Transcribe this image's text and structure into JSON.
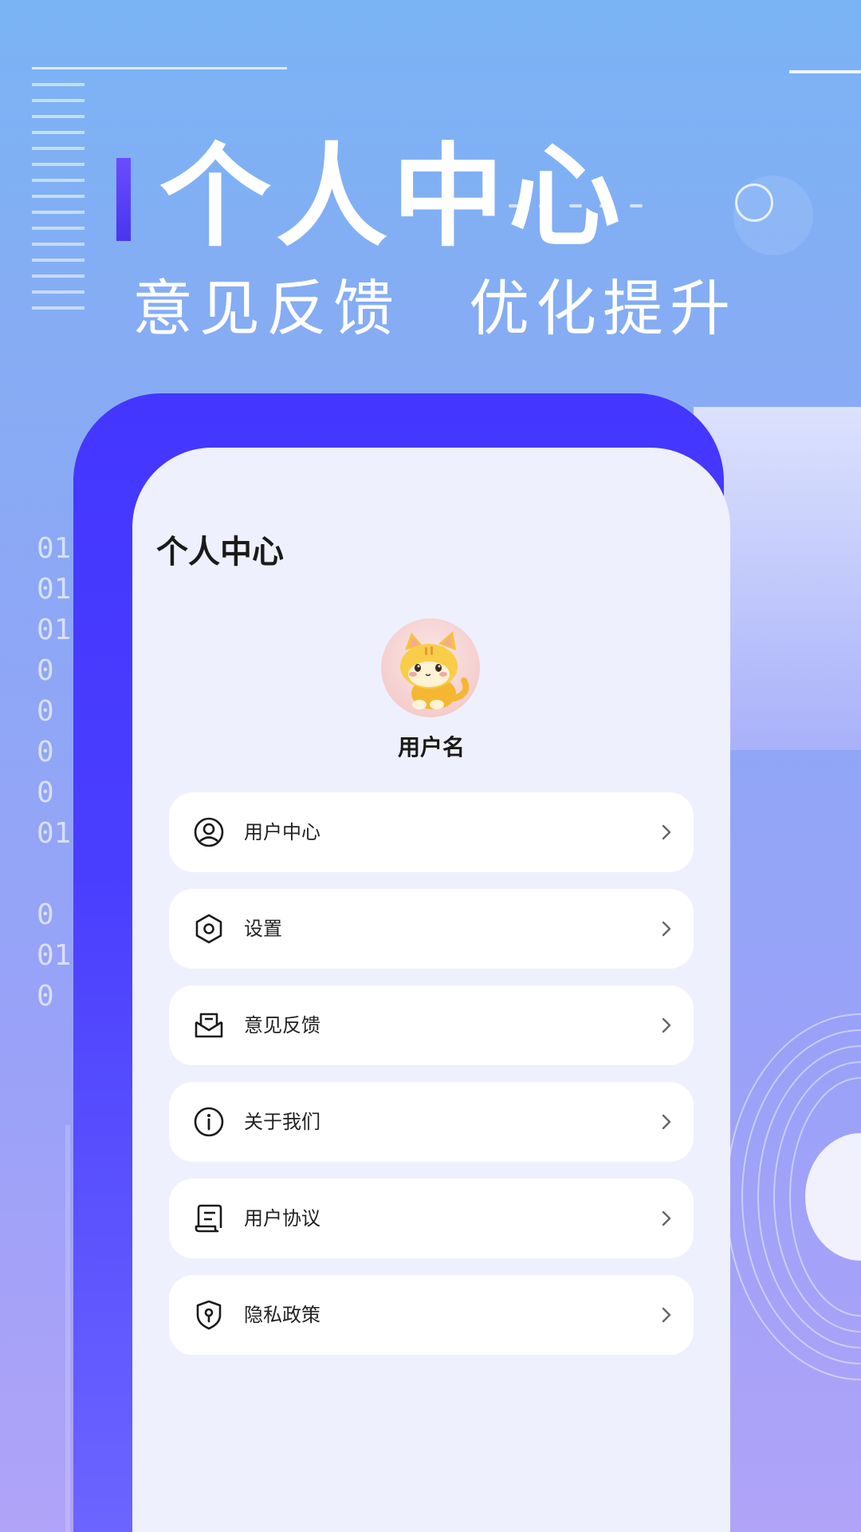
{
  "hero": {
    "title": "个人中心",
    "subtitle_left": "意见反馈",
    "subtitle_right": "优化提升"
  },
  "background": {
    "binary_rows": [
      "01",
      "01",
      "01",
      "0",
      "0",
      "0",
      "0",
      "01",
      "",
      "0",
      "01",
      "0"
    ]
  },
  "colors": {
    "accent": "#4436ff",
    "screen_bg": "#eef0fd",
    "card_bg": "#ffffff",
    "text_primary": "#1a1a1a"
  },
  "screen": {
    "page_title": "个人中心",
    "username": "用户名",
    "avatar_icon": "cat-avatar"
  },
  "menu": {
    "items": [
      {
        "label": "用户中心",
        "icon": "user-circle-icon"
      },
      {
        "label": "设置",
        "icon": "settings-hexagon-icon"
      },
      {
        "label": "意见反馈",
        "icon": "feedback-mail-icon"
      },
      {
        "label": "关于我们",
        "icon": "info-circle-icon"
      },
      {
        "label": "用户协议",
        "icon": "document-scroll-icon"
      },
      {
        "label": "隐私政策",
        "icon": "privacy-shield-icon"
      }
    ]
  }
}
